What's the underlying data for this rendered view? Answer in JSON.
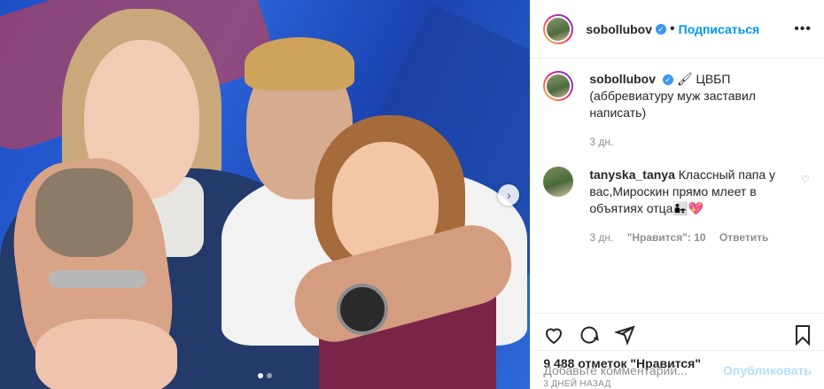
{
  "media": {
    "slide_dots": 2,
    "active_dot": 0
  },
  "header": {
    "username": "sobollubov",
    "separator": "•",
    "follow_label": "Подписаться",
    "more_label": "•••"
  },
  "caption": {
    "username": "sobollubov",
    "text": "🖌 ЦВБП (аббревиатуру муж заставил написать)",
    "time": "3 дн."
  },
  "comments": [
    {
      "username": "tanyska_tanya",
      "text": "Классный папа у вас,Мироскин прямо млеет в объятиях отца👨‍👧💖",
      "time": "3 дн.",
      "likes": "\"Нравится\": 10",
      "reply": "Ответить"
    }
  ],
  "actions": {
    "likes_text": "9 488 отметок \"Нравится\"",
    "date": "3 ДНЕЙ НАЗАД"
  },
  "add_comment": {
    "placeholder": "Добавьте комментарий...",
    "publish": "Опубликовать"
  },
  "icons": {
    "like": "heart-icon",
    "comment": "comment-icon",
    "share": "share-icon",
    "save": "bookmark-icon",
    "next": "chevron-right-icon",
    "verified": "verified-icon"
  },
  "colors": {
    "accent": "#0095f6",
    "muted": "#8e8e8e",
    "publish_disabled": "#b2dffc"
  }
}
